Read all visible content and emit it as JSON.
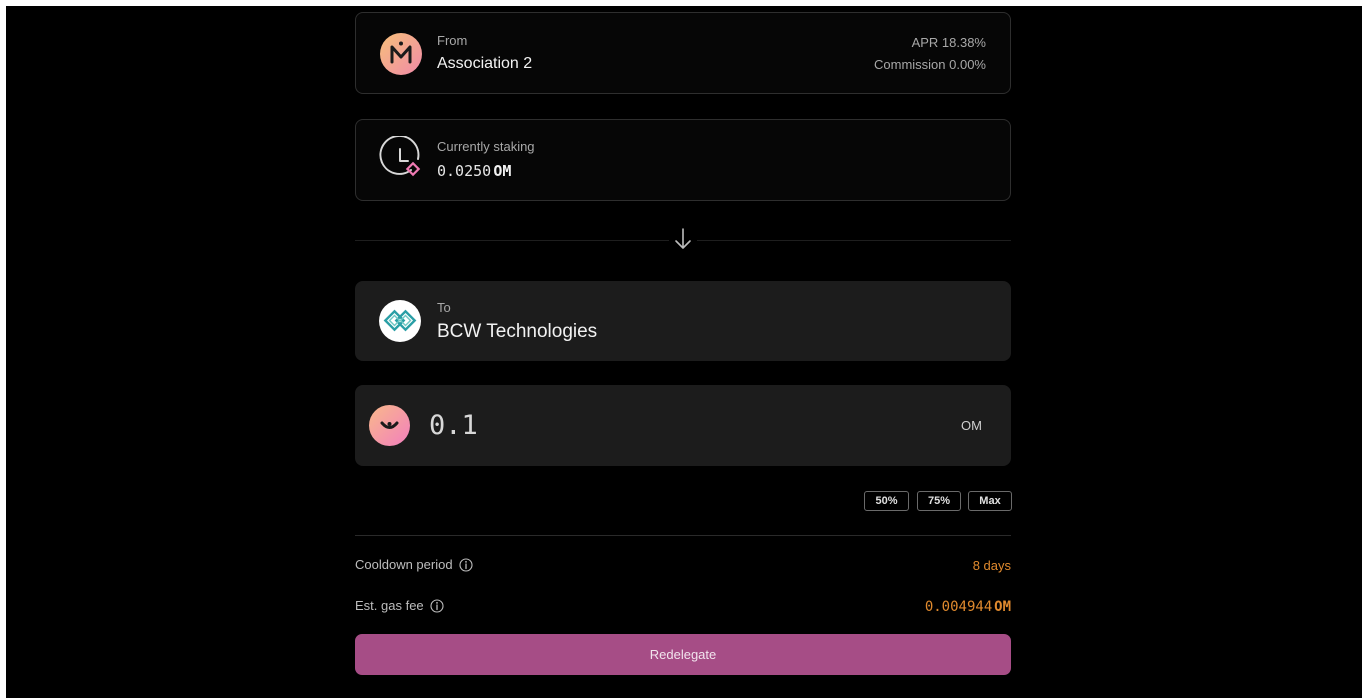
{
  "from_card": {
    "caption": "From",
    "validator_name": "Association 2",
    "apr": "APR 18.38%",
    "commission": "Commission 0.00%",
    "logo_icon": "validator-m-logo-icon"
  },
  "staking_card": {
    "caption": "Currently staking",
    "amount_digits": "0.0250",
    "amount_unit": "OM",
    "icon": "clock-stake-icon"
  },
  "divider": {
    "icon": "arrow-down-icon"
  },
  "to_card": {
    "caption": "To",
    "validator_name": "BCW Technologies",
    "logo_icon": "bcw-logo-icon"
  },
  "amount_input": {
    "value": "0.1",
    "unit": "OM",
    "token_icon": "om-token-icon"
  },
  "quick_amounts": [
    "50%",
    "75%",
    "Max"
  ],
  "details": {
    "cooldown_label": "Cooldown period",
    "cooldown_value": "8 days",
    "gas_label": "Est. gas fee",
    "gas_value_digits": "0.004944",
    "gas_value_unit": "OM"
  },
  "submit_button": {
    "label": "Redelegate"
  },
  "colors": {
    "accent_button": "#a64d86",
    "value_orange": "#e08a2e",
    "background": "#000000"
  }
}
